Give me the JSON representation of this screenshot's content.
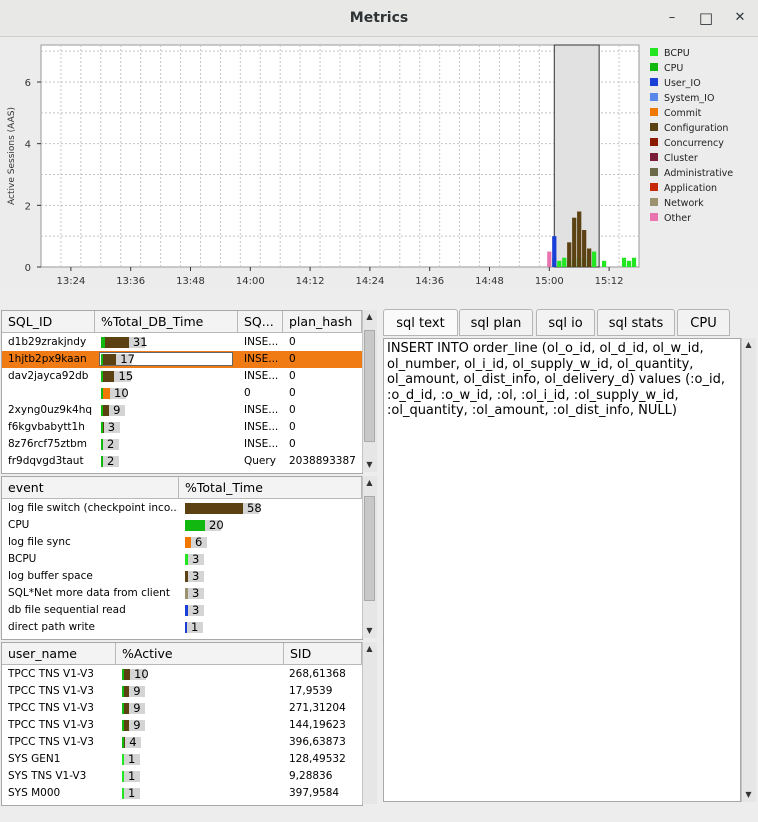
{
  "window": {
    "title": "Metrics",
    "minimize": "–",
    "maximize": "□",
    "close": "✕"
  },
  "chart_data": {
    "type": "area",
    "ylabel": "Active Sessions (AAS)",
    "yticks": [
      "0",
      "2",
      "4",
      "6"
    ],
    "ylim": [
      0,
      7.2
    ],
    "xticks": [
      "13:24",
      "13:36",
      "13:48",
      "14:00",
      "14:12",
      "14:24",
      "14:36",
      "14:48",
      "15:00",
      "15:12"
    ],
    "legend": [
      {
        "name": "BCPU",
        "color": "#22e622"
      },
      {
        "name": "CPU",
        "color": "#10b810"
      },
      {
        "name": "User_IO",
        "color": "#1a3fd6"
      },
      {
        "name": "System_IO",
        "color": "#5a88e8"
      },
      {
        "name": "Commit",
        "color": "#f07800"
      },
      {
        "name": "Configuration",
        "color": "#5c4213"
      },
      {
        "name": "Concurrency",
        "color": "#8b1a00"
      },
      {
        "name": "Cluster",
        "color": "#7a1f3a"
      },
      {
        "name": "Administrative",
        "color": "#6b6b4a"
      },
      {
        "name": "Application",
        "color": "#c8280a"
      },
      {
        "name": "Network",
        "color": "#9c9270"
      },
      {
        "name": "Other",
        "color": "#ea74b0"
      }
    ],
    "selection": [
      "15:01",
      "15:10"
    ],
    "series": [
      {
        "name": "BCPU",
        "x": [
          "15:00",
          "15:01",
          "15:02",
          "15:03",
          "15:04",
          "15:05",
          "15:06",
          "15:07",
          "15:08",
          "15:09",
          "15:11",
          "15:15",
          "15:16",
          "15:17"
        ],
        "y": [
          0.1,
          0.3,
          0.2,
          0.3,
          0.2,
          0.3,
          0.3,
          0.3,
          0.3,
          0.5,
          0.2,
          0.3,
          0.2,
          0.3
        ]
      },
      {
        "name": "User_IO",
        "x": [
          "15:01"
        ],
        "y": [
          1.0
        ]
      },
      {
        "name": "Other",
        "x": [
          "15:00"
        ],
        "y": [
          0.5
        ]
      },
      {
        "name": "Configuration",
        "x": [
          "15:04",
          "15:05",
          "15:06",
          "15:07",
          "15:08"
        ],
        "y": [
          0.8,
          1.6,
          1.8,
          1.2,
          0.6
        ]
      }
    ]
  },
  "sql_table": {
    "headers": [
      "SQL_ID",
      "%Total_DB_Time",
      "SQ...",
      "plan_hash"
    ],
    "rows": [
      {
        "id": "d1b29zrakjndy",
        "pct": 31,
        "sq": "INSE...",
        "plan": "0",
        "colors": [
          "#10b810",
          "#5c4213"
        ]
      },
      {
        "id": "1hjtb2px9kaan",
        "pct": 17,
        "sq": "INSE...",
        "plan": "0",
        "colors": [
          "#10b810",
          "#5c4213"
        ]
      },
      {
        "id": "dav2jayca92db",
        "pct": 15,
        "sq": "INSE...",
        "plan": "0",
        "colors": [
          "#10b810",
          "#5c4213"
        ]
      },
      {
        "id": "",
        "pct": 10,
        "sq": "0",
        "plan": "0",
        "colors": [
          "#10b810",
          "#f07800"
        ]
      },
      {
        "id": "2xyng0uz9k4hq",
        "pct": 9,
        "sq": "INSE...",
        "plan": "0",
        "colors": [
          "#10b810",
          "#5c4213"
        ]
      },
      {
        "id": "f6kgvbabytt1h",
        "pct": 3,
        "sq": "INSE...",
        "plan": "0",
        "colors": [
          "#10b810",
          "#5c4213"
        ]
      },
      {
        "id": "8z76rcf75ztbm",
        "pct": 2,
        "sq": "INSE...",
        "plan": "0",
        "colors": [
          "#10b810",
          "#5c4213"
        ]
      },
      {
        "id": "fr9dqvgd3taut",
        "pct": 2,
        "sq": "Query",
        "plan": "2038893387",
        "colors": [
          "#10b810",
          "#5c4213"
        ]
      }
    ]
  },
  "event_table": {
    "headers": [
      "event",
      "%Total_Time"
    ],
    "rows": [
      {
        "event": "log file switch (checkpoint inco...",
        "pct": 58,
        "color": "#5c4213"
      },
      {
        "event": "CPU",
        "pct": 20,
        "color": "#10b810"
      },
      {
        "event": "log file sync",
        "pct": 6,
        "color": "#f07800"
      },
      {
        "event": "BCPU",
        "pct": 3,
        "color": "#22e622"
      },
      {
        "event": "log buffer space",
        "pct": 3,
        "color": "#5c4213"
      },
      {
        "event": "SQL*Net more data from client",
        "pct": 3,
        "color": "#9c9270"
      },
      {
        "event": "db file sequential read",
        "pct": 3,
        "color": "#1a3fd6"
      },
      {
        "event": "direct path write",
        "pct": 1,
        "color": "#1a3fd6"
      }
    ]
  },
  "session_table": {
    "headers": [
      "user_name",
      "%Active",
      "SID"
    ],
    "rows": [
      {
        "user": "TPCC TNS V1-V3",
        "pct": 10,
        "sid": "268,61368"
      },
      {
        "user": "TPCC TNS V1-V3",
        "pct": 9,
        "sid": "17,9539"
      },
      {
        "user": "TPCC TNS V1-V3",
        "pct": 9,
        "sid": "271,31204"
      },
      {
        "user": "TPCC TNS V1-V3",
        "pct": 9,
        "sid": "144,19623"
      },
      {
        "user": "TPCC TNS V1-V3",
        "pct": 4,
        "sid": "396,63873"
      },
      {
        "user": "SYS GEN1",
        "pct": 1,
        "sid": "128,49532"
      },
      {
        "user": "SYS TNS V1-V3",
        "pct": 1,
        "sid": "9,28836"
      },
      {
        "user": "SYS M000",
        "pct": 1,
        "sid": "397,9584"
      }
    ]
  },
  "tabs": [
    "sql text",
    "sql plan",
    "sql io",
    "sql stats",
    "CPU"
  ],
  "sql_text": "INSERT INTO order_line (ol_o_id, ol_d_id, ol_w_id,\nol_number, ol_i_id, ol_supply_w_id, ol_quantity,\nol_amount, ol_dist_info, ol_delivery_d) values (:o_id,\n:o_d_id, :o_w_id, :ol, :ol_i_id, :ol_supply_w_id,\n:ol_quantity, :ol_amount, :ol_dist_info, NULL)"
}
